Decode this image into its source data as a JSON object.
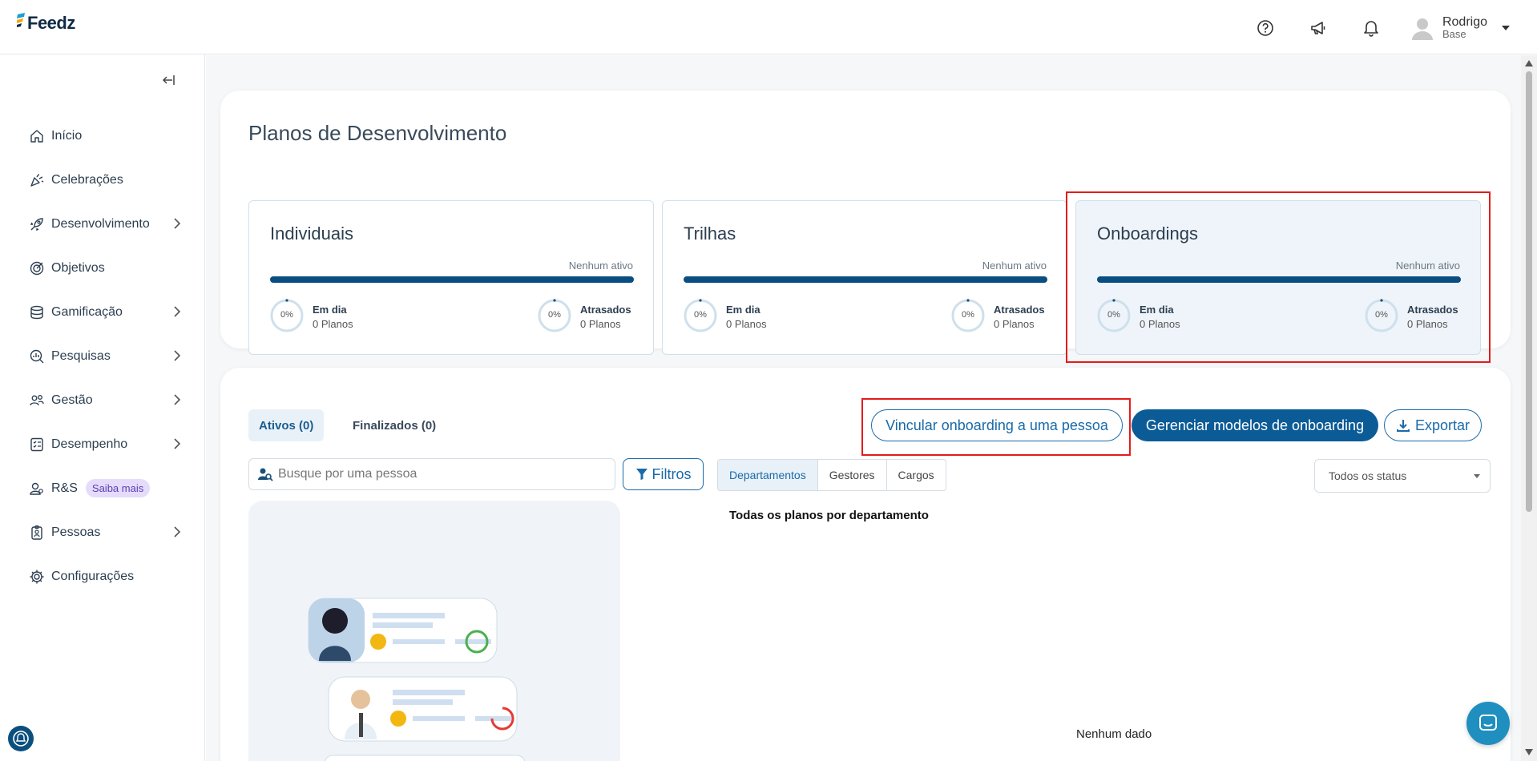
{
  "brand": {
    "name": "Feedz"
  },
  "header": {
    "user_name": "Rodrigo",
    "user_role": "Base",
    "icons": [
      "help-icon",
      "megaphone-icon",
      "bell-icon",
      "avatar",
      "caret-down-icon"
    ]
  },
  "sidebar": {
    "items": [
      {
        "label": "Início",
        "icon": "home-icon",
        "has_children": false
      },
      {
        "label": "Celebrações",
        "icon": "party-icon",
        "has_children": false
      },
      {
        "label": "Desenvolvimento",
        "icon": "rocket-icon",
        "has_children": true
      },
      {
        "label": "Objetivos",
        "icon": "target-icon",
        "has_children": false
      },
      {
        "label": "Gamificação",
        "icon": "coins-icon",
        "has_children": true
      },
      {
        "label": "Pesquisas",
        "icon": "survey-icon",
        "has_children": true
      },
      {
        "label": "Gestão",
        "icon": "people-icon",
        "has_children": true
      },
      {
        "label": "Desempenho",
        "icon": "checklist-icon",
        "has_children": true
      },
      {
        "label": "R&S",
        "icon": "recruit-icon",
        "has_children": false,
        "badge": "Saiba mais"
      },
      {
        "label": "Pessoas",
        "icon": "badge-icon",
        "has_children": true
      },
      {
        "label": "Configurações",
        "icon": "gear-icon",
        "has_children": false
      }
    ]
  },
  "page": {
    "title": "Planos de Desenvolvimento",
    "stats": [
      {
        "title": "Individuais",
        "status": "Nenhum ativo",
        "on_time_pct": "0%",
        "on_time_label": "Em dia",
        "on_time_value": "0 Planos",
        "late_pct": "0%",
        "late_label": "Atrasados",
        "late_value": "0 Planos"
      },
      {
        "title": "Trilhas",
        "status": "Nenhum ativo",
        "on_time_pct": "0%",
        "on_time_label": "Em dia",
        "on_time_value": "0 Planos",
        "late_pct": "0%",
        "late_label": "Atrasados",
        "late_value": "0 Planos"
      },
      {
        "title": "Onboardings",
        "status": "Nenhum ativo",
        "on_time_pct": "0%",
        "on_time_label": "Em dia",
        "on_time_value": "0 Planos",
        "late_pct": "0%",
        "late_label": "Atrasados",
        "late_value": "0 Planos"
      }
    ],
    "tabs": [
      {
        "label": "Ativos (0)",
        "active": true
      },
      {
        "label": "Finalizados (0)",
        "active": false
      }
    ],
    "actions": {
      "link_onboarding": "Vincular onboarding a uma pessoa",
      "manage_models": "Gerenciar modelos de onboarding",
      "export": "Exportar"
    },
    "search_placeholder": "Busque por uma pessoa",
    "filters_label": "Filtros",
    "segments": [
      {
        "label": "Departamentos",
        "active": true
      },
      {
        "label": "Gestores",
        "active": false
      },
      {
        "label": "Cargos",
        "active": false
      }
    ],
    "status_select": "Todos os status",
    "chart_title": "Todas os planos por departamento",
    "no_data": "Nenhum dado"
  },
  "colors": {
    "primary": "#0b5b96",
    "progress_bar": "#0a4d80",
    "highlight": "#e41b1b",
    "badge_bg": "#e5dcfb"
  }
}
